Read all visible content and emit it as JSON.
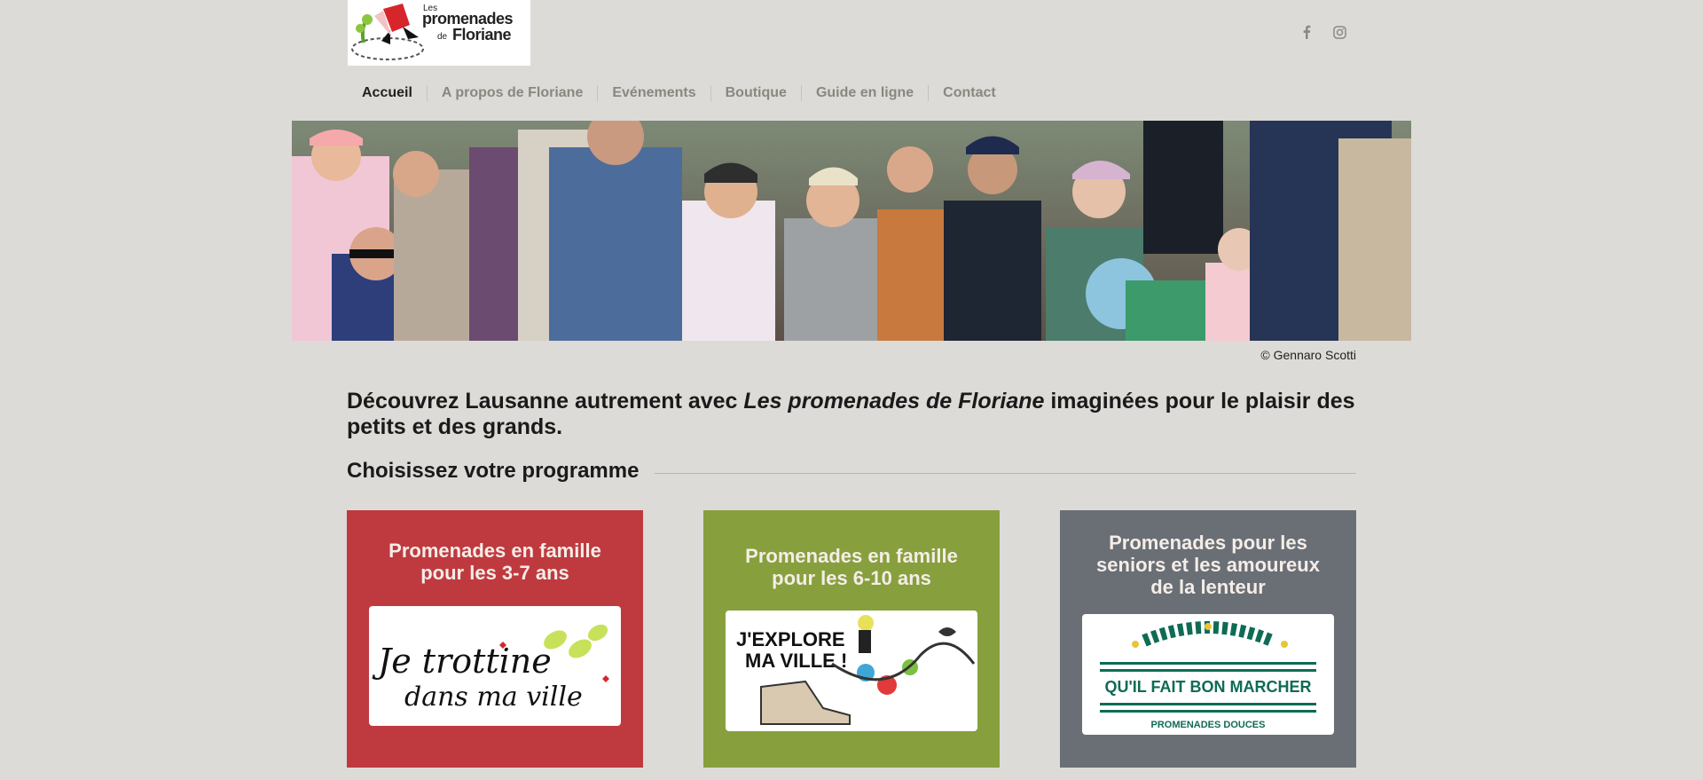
{
  "logo": {
    "les": "Les",
    "promenades": "promenades",
    "de": "de",
    "floriane": "Floriane"
  },
  "social": {
    "facebook_icon": "facebook-icon",
    "instagram_icon": "instagram-icon"
  },
  "nav": {
    "items": [
      {
        "label": "Accueil",
        "active": true
      },
      {
        "label": "A propos de Floriane",
        "active": false
      },
      {
        "label": "Evénements",
        "active": false
      },
      {
        "label": "Boutique",
        "active": false
      },
      {
        "label": "Guide en ligne",
        "active": false
      },
      {
        "label": "Contact",
        "active": false
      }
    ]
  },
  "hero": {
    "credit": "© Gennaro Scotti"
  },
  "intro": {
    "before": "Découvrez Lausanne autrement avec ",
    "emphasis": "Les promenades de Floriane",
    "after": " imaginées pour le plaisir des petits et des grands."
  },
  "section": {
    "heading": "Choisissez votre programme"
  },
  "cards": [
    {
      "title_line1": "Promenades en famille",
      "title_line2": "pour les 3-7 ans",
      "image_text_line1": "Je trottine",
      "image_text_line2": "dans ma ville",
      "color": "#bf3a3f"
    },
    {
      "title_line1": "Promenades en famille",
      "title_line2": "pour les 6-10 ans",
      "image_text_line1": "J'EXPLORE",
      "image_text_line2": "MA VILLE !",
      "color": "#87a03d"
    },
    {
      "title_line1": "Promenades pour les",
      "title_line2": "seniors et les amoureux",
      "title_line3": "de la lenteur",
      "image_text_line1": "QU'IL FAIT BON MARCHER",
      "image_text_line2": "PROMENADES DOUCES",
      "color": "#696f75"
    }
  ]
}
